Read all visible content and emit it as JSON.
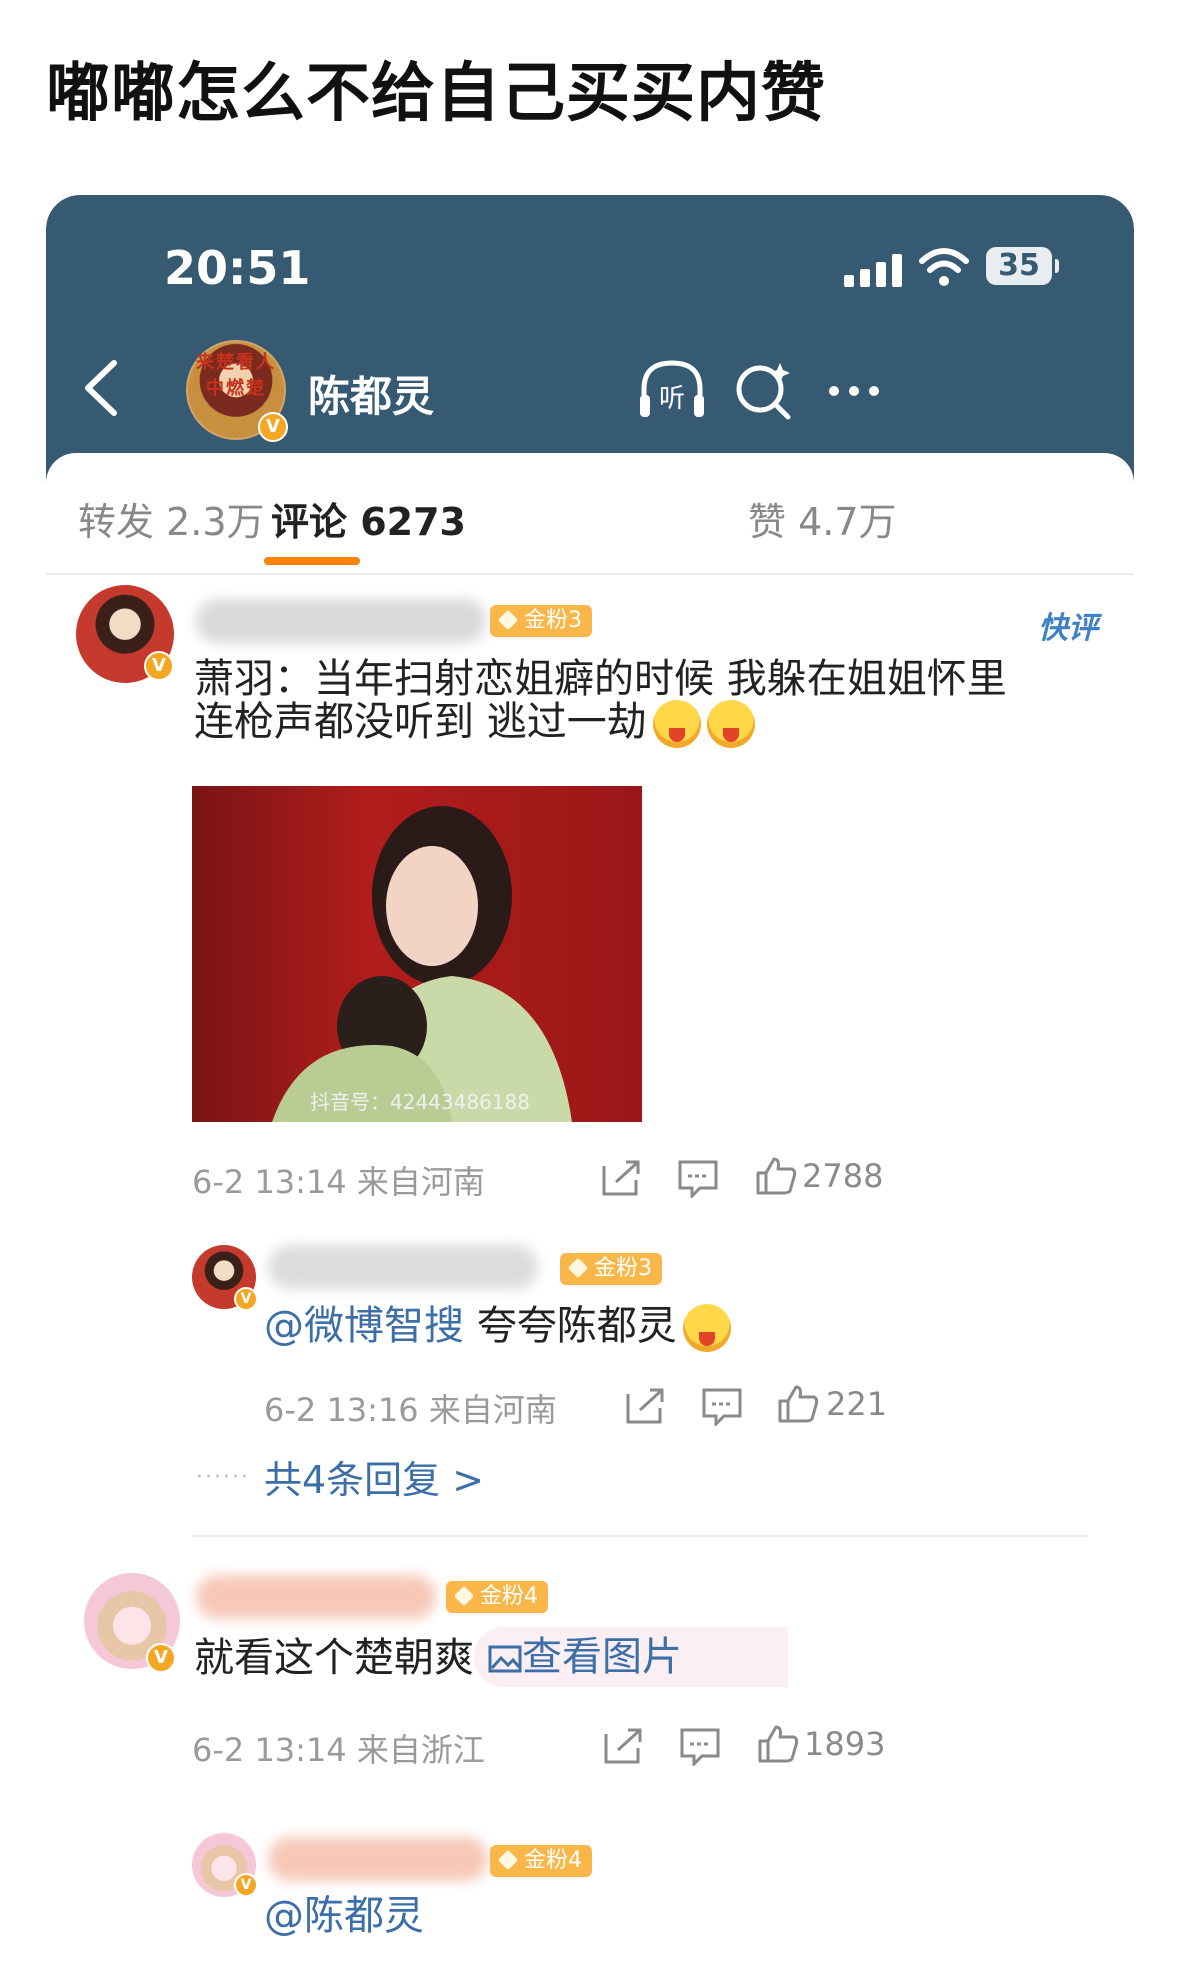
{
  "post": {
    "title": "嘟嘟怎么不给自己买买内赞"
  },
  "status_bar": {
    "time": "20:51",
    "battery": "35"
  },
  "header": {
    "profile_name": "陈都灵",
    "avatar_text": "来楚看人中燃楚",
    "listen_label": "听"
  },
  "tabs": [
    {
      "label": "转发 2.3万",
      "active": false
    },
    {
      "label": "评论 6273",
      "active": true
    },
    {
      "label": "赞 4.7万",
      "active": false
    }
  ],
  "comments": [
    {
      "badge": "金粉3",
      "quick_label": "快评",
      "text_line1": "萧羽：当年扫射恋姐癖的时候 我躲在姐姐怀里",
      "text_line2": "连枪声都没听到 逃过一劫",
      "image_watermark": "抖音号：42443486188",
      "meta": "6-2 13:14 来自河南",
      "likes": "2788",
      "reply": {
        "badge": "金粉3",
        "mention": "@微博智搜",
        "text": " 夸夸陈都灵",
        "meta": "6-2 13:16 来自河南",
        "likes": "221"
      },
      "more_replies": "共4条回复 >"
    },
    {
      "badge": "金粉4",
      "text": "就看这个楚朝爽",
      "view_image": "查看图片",
      "meta": "6-2 13:14 来自浙江",
      "likes": "1893",
      "reply": {
        "badge": "金粉4",
        "mention": "@陈都灵"
      }
    }
  ],
  "colors": {
    "header_bg": "#365a72",
    "accent_orange": "#ff8200",
    "link_blue": "#3c6ea8",
    "badge_gold": "#f9b74a"
  }
}
